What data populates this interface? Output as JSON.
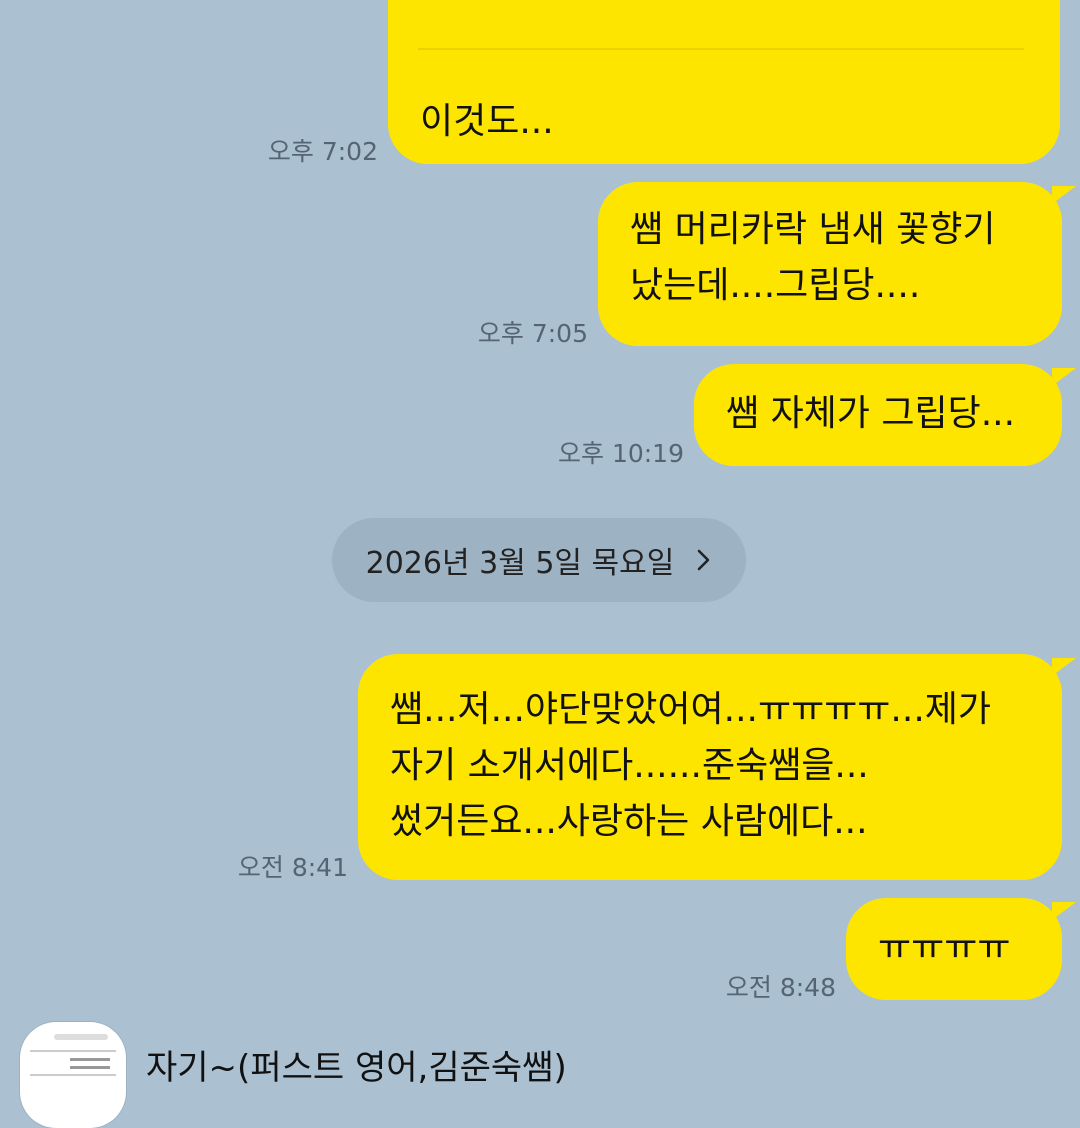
{
  "messages": [
    {
      "lines": [
        "이것도..."
      ],
      "time": "오후 7:02"
    },
    {
      "lines": [
        "쌤 머리카락 냄새 꽃향기",
        "났는데....그립당...."
      ],
      "time": "오후 7:05"
    },
    {
      "lines": [
        "쌤 자체가 그립당..."
      ],
      "time": "오후 10:19"
    },
    {
      "lines": [
        "쌤...저...야단맞았어여...ㅠㅠㅠㅠ...제가",
        "자기 소개서에다......준숙쌤을...",
        "썼거든요...사랑하는 사람에다..."
      ],
      "time": "오전 8:41"
    },
    {
      "lines": [
        "ㅠㅠㅠㅠ"
      ],
      "time": "오전 8:48"
    }
  ],
  "date_divider": "2026년 3월 5일 목요일",
  "chat_preview": {
    "title": "자기~(퍼스트 영어,김준숙쌤)"
  },
  "colors": {
    "background": "#abc1d1",
    "bubble": "#fee500",
    "date_pill": "#9db3c4"
  }
}
